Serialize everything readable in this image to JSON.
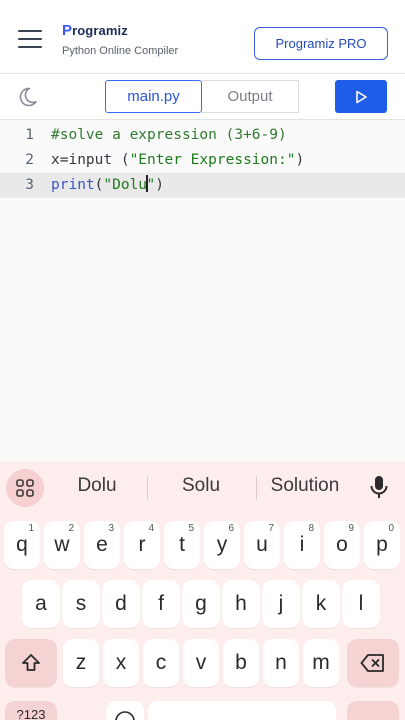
{
  "header": {
    "logo_name_first": "P",
    "logo_name_rest": "rogramiz",
    "logo_sub": "Python Online Compiler",
    "pro_button": "Programiz PRO"
  },
  "toolbar": {
    "tab_main": "main.py",
    "tab_output": "Output"
  },
  "editor": {
    "lines": [
      {
        "num": "1",
        "text": "#solve a expression (3+6-9)"
      },
      {
        "num": "2",
        "text_plain": "x=input (",
        "text_str": "\"Enter Expression:\"",
        "text_end": ")"
      },
      {
        "num": "3",
        "text_kw": "print",
        "text_open": "(",
        "text_str_a": "\"Dolu",
        "text_str_b": "\"",
        "text_end": ")"
      }
    ]
  },
  "keyboard": {
    "suggestions": [
      "Dolu",
      "Solu",
      "Solution"
    ],
    "row1": [
      {
        "k": "q",
        "n": "1"
      },
      {
        "k": "w",
        "n": "2"
      },
      {
        "k": "e",
        "n": "3"
      },
      {
        "k": "r",
        "n": "4"
      },
      {
        "k": "t",
        "n": "5"
      },
      {
        "k": "y",
        "n": "6"
      },
      {
        "k": "u",
        "n": "7"
      },
      {
        "k": "i",
        "n": "8"
      },
      {
        "k": "o",
        "n": "9"
      },
      {
        "k": "p",
        "n": "0"
      }
    ],
    "row2": [
      "a",
      "s",
      "d",
      "f",
      "g",
      "h",
      "j",
      "k",
      "l"
    ],
    "row3": [
      "z",
      "x",
      "c",
      "v",
      "b",
      "n",
      "m"
    ],
    "bottom_left_label": "?123"
  },
  "colors": {
    "accent": "#1f5de8",
    "keyboard_bg": "#fdeeed",
    "special_key": "#f6d3d3"
  }
}
